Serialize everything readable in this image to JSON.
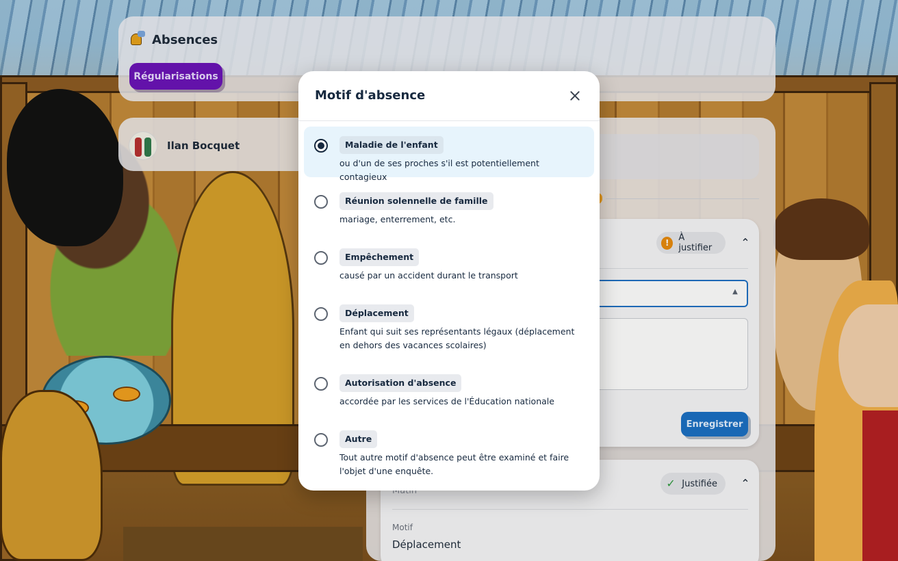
{
  "page": {
    "section_title": "Absences",
    "regularisations_button": "Régularisations",
    "child_name": "Ilan Bocquet"
  },
  "cards": {
    "first": {
      "status": "À justifier",
      "save_button": "Enregistrer"
    },
    "second": {
      "period_partial": "Matin",
      "status": "Justifiée",
      "motif_label": "Motif",
      "motif_value": "Déplacement"
    }
  },
  "modal": {
    "title": "Motif d'absence",
    "selected_index": 0,
    "options": [
      {
        "label": "Maladie de l'enfant",
        "description": "ou d'un de ses proches s'il est potentiellement contagieux"
      },
      {
        "label": "Réunion solennelle de famille",
        "description": "mariage, enterrement, etc."
      },
      {
        "label": "Empêchement",
        "description": "causé par un accident durant le transport"
      },
      {
        "label": "Déplacement",
        "description": "Enfant qui suit ses représentants légaux (déplacement en dehors des vacances scolaires)"
      },
      {
        "label": "Autorisation d'absence",
        "description": "accordée par les services de l'Éducation nationale"
      },
      {
        "label": "Autre",
        "description": "Tout autre motif d'absence peut être examiné et faire l'objet d'une enquête."
      }
    ]
  },
  "colors": {
    "primary_purple": "#6a12b8",
    "primary_blue": "#1a6fc4",
    "selected_bg": "#e7f4fc",
    "warning": "#e88a0e",
    "success": "#2e9a3e",
    "text_dark": "#17293f"
  },
  "icons": {
    "section": "bell-icon",
    "close": "close-icon",
    "warning": "warning-icon",
    "check": "check-icon",
    "expand": "chevron-up-icon",
    "select": "caret-up-icon"
  }
}
